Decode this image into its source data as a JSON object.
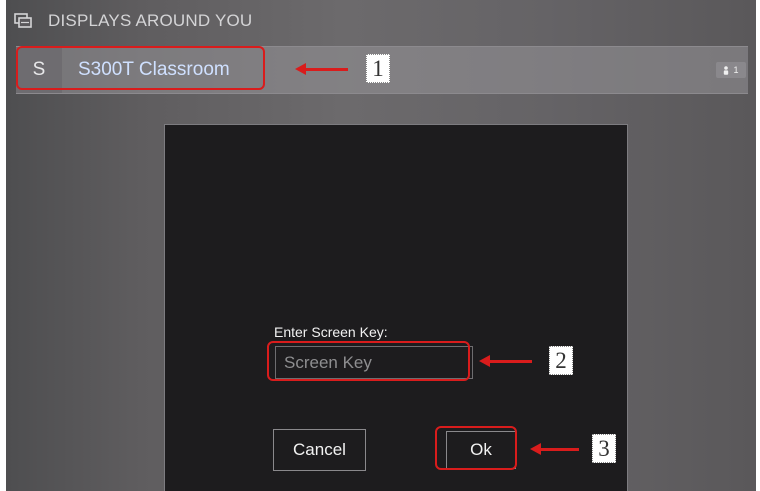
{
  "header": {
    "title": "DISPLAYS AROUND YOU",
    "icon": "displays-icon"
  },
  "device": {
    "letter": "S",
    "name": "S300T Classroom",
    "user_count": "1",
    "count_icon": "person-icon"
  },
  "dialog": {
    "label": "Enter Screen Key:",
    "input_placeholder": "Screen Key",
    "input_value": "",
    "cancel_label": "Cancel",
    "ok_label": "Ok"
  },
  "annotations": {
    "steps": [
      "1",
      "2",
      "3"
    ],
    "color": "#d91c1c"
  },
  "colors": {
    "dialog_background": "#1d1c1e",
    "device_name": "#cfe0ff",
    "header_text": "#d4d4d6"
  }
}
